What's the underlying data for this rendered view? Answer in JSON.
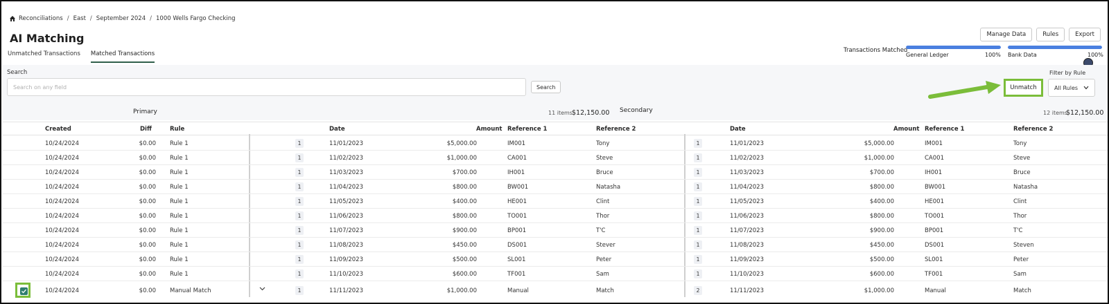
{
  "breadcrumb": [
    "Reconciliations",
    "East",
    "September 2024",
    "1000 Wells Fargo Checking"
  ],
  "page_title": "AI Matching",
  "tabs": [
    {
      "label": "Unmatched Transactions",
      "active": false
    },
    {
      "label": "Matched Transactions",
      "active": true
    }
  ],
  "header_buttons": {
    "manage_data": "Manage Data",
    "rules": "Rules",
    "export": "Export"
  },
  "transactions_matched": {
    "label": "Transactions Matched",
    "general_ledger": {
      "label": "General Ledger",
      "percent": "100%",
      "value": 1.0
    },
    "bank_data": {
      "label": "Bank Data",
      "percent": "100%",
      "value": 1.0
    }
  },
  "search": {
    "label": "Search",
    "placeholder": "Search on any field",
    "value": "",
    "button": "Search"
  },
  "unmatch_button": "Unmatch",
  "filter": {
    "label": "Filter by Rule",
    "selected": "All Rules"
  },
  "primary": {
    "title": "Primary",
    "items": "11 items",
    "total": "$12,150.00"
  },
  "secondary": {
    "title": "Secondary",
    "items": "12 items",
    "total": "$12,150.00"
  },
  "columns": {
    "created": "Created",
    "diff": "Diff",
    "rule": "Rule",
    "p_date": "Date",
    "p_amount": "Amount",
    "p_ref1": "Reference 1",
    "p_ref2": "Reference 2",
    "s_date": "Date",
    "s_amount": "Amount",
    "s_ref1": "Reference 1",
    "s_ref2": "Reference 2"
  },
  "rows": [
    {
      "created": "10/24/2024",
      "diff": "$0.00",
      "rule": "Rule 1",
      "p_count": "1",
      "p_date": "11/01/2023",
      "p_amount": "$5,000.00",
      "p_ref1": "IM001",
      "p_ref2": "Tony",
      "s_count": "1",
      "s_date": "11/01/2023",
      "s_amount": "$5,000.00",
      "s_ref1": "IM001",
      "s_ref2": "Tony"
    },
    {
      "created": "10/24/2024",
      "diff": "$0.00",
      "rule": "Rule 1",
      "p_count": "1",
      "p_date": "11/02/2023",
      "p_amount": "$1,000.00",
      "p_ref1": "CA001",
      "p_ref2": "Steve",
      "s_count": "1",
      "s_date": "11/02/2023",
      "s_amount": "$1,000.00",
      "s_ref1": "CA001",
      "s_ref2": "Steve"
    },
    {
      "created": "10/24/2024",
      "diff": "$0.00",
      "rule": "Rule 1",
      "p_count": "1",
      "p_date": "11/03/2023",
      "p_amount": "$700.00",
      "p_ref1": "IH001",
      "p_ref2": "Bruce",
      "s_count": "1",
      "s_date": "11/03/2023",
      "s_amount": "$700.00",
      "s_ref1": "IH001",
      "s_ref2": "Bruce"
    },
    {
      "created": "10/24/2024",
      "diff": "$0.00",
      "rule": "Rule 1",
      "p_count": "1",
      "p_date": "11/04/2023",
      "p_amount": "$800.00",
      "p_ref1": "BW001",
      "p_ref2": "Natasha",
      "s_count": "1",
      "s_date": "11/04/2023",
      "s_amount": "$800.00",
      "s_ref1": "BW001",
      "s_ref2": "Natasha"
    },
    {
      "created": "10/24/2024",
      "diff": "$0.00",
      "rule": "Rule 1",
      "p_count": "1",
      "p_date": "11/05/2023",
      "p_amount": "$400.00",
      "p_ref1": "HE001",
      "p_ref2": "Clint",
      "s_count": "1",
      "s_date": "11/05/2023",
      "s_amount": "$400.00",
      "s_ref1": "HE001",
      "s_ref2": "Clint"
    },
    {
      "created": "10/24/2024",
      "diff": "$0.00",
      "rule": "Rule 1",
      "p_count": "1",
      "p_date": "11/06/2023",
      "p_amount": "$800.00",
      "p_ref1": "TO001",
      "p_ref2": "Thor",
      "s_count": "1",
      "s_date": "11/06/2023",
      "s_amount": "$800.00",
      "s_ref1": "TO001",
      "s_ref2": "Thor"
    },
    {
      "created": "10/24/2024",
      "diff": "$0.00",
      "rule": "Rule 1",
      "p_count": "1",
      "p_date": "11/07/2023",
      "p_amount": "$900.00",
      "p_ref1": "BP001",
      "p_ref2": "T'C",
      "s_count": "1",
      "s_date": "11/07/2023",
      "s_amount": "$900.00",
      "s_ref1": "BP001",
      "s_ref2": "T'C"
    },
    {
      "created": "10/24/2024",
      "diff": "$0.00",
      "rule": "Rule 1",
      "p_count": "1",
      "p_date": "11/08/2023",
      "p_amount": "$450.00",
      "p_ref1": "DS001",
      "p_ref2": "Stever",
      "s_count": "1",
      "s_date": "11/08/2023",
      "s_amount": "$450.00",
      "s_ref1": "DS001",
      "s_ref2": "Steven"
    },
    {
      "created": "10/24/2024",
      "diff": "$0.00",
      "rule": "Rule 1",
      "p_count": "1",
      "p_date": "11/09/2023",
      "p_amount": "$500.00",
      "p_ref1": "SL001",
      "p_ref2": "Peter",
      "s_count": "1",
      "s_date": "11/09/2023",
      "s_amount": "$500.00",
      "s_ref1": "SL001",
      "s_ref2": "Peter"
    },
    {
      "created": "10/24/2024",
      "diff": "$0.00",
      "rule": "Rule 1",
      "p_count": "1",
      "p_date": "11/10/2023",
      "p_amount": "$600.00",
      "p_ref1": "TF001",
      "p_ref2": "Sam",
      "s_count": "1",
      "s_date": "11/10/2023",
      "s_amount": "$600.00",
      "s_ref1": "TF001",
      "s_ref2": "Sam"
    },
    {
      "created": "10/24/2024",
      "diff": "$0.00",
      "rule": "Manual Match",
      "p_count": "1",
      "p_date": "11/11/2023",
      "p_amount": "$1,000.00",
      "p_ref1": "Manual",
      "p_ref2": "Match",
      "s_count": "2",
      "s_date": "11/11/2023",
      "s_amount": "$1,000.00",
      "s_ref1": "Manual",
      "s_ref2": "Match",
      "checked": true,
      "expandable": true
    }
  ],
  "colors": {
    "accent": "#4a7fe0",
    "highlight": "#7bbd3a",
    "checkbox": "#2e7d6e"
  }
}
